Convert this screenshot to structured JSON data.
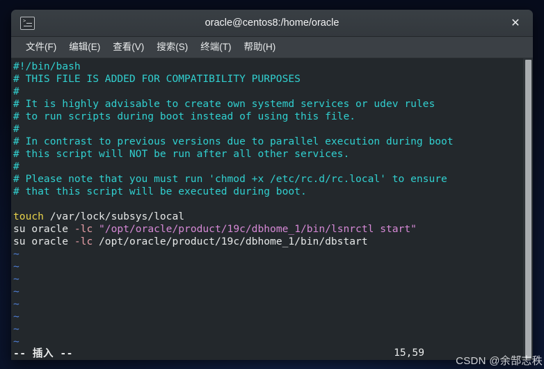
{
  "window": {
    "title": "oracle@centos8:/home/oracle",
    "icon": "terminal-icon",
    "close_label": "✕"
  },
  "menubar": {
    "items": [
      {
        "label": "文件(F)",
        "name": "menu-file"
      },
      {
        "label": "编辑(E)",
        "name": "menu-edit"
      },
      {
        "label": "查看(V)",
        "name": "menu-view"
      },
      {
        "label": "搜索(S)",
        "name": "menu-search"
      },
      {
        "label": "终端(T)",
        "name": "menu-terminal"
      },
      {
        "label": "帮助(H)",
        "name": "menu-help"
      }
    ]
  },
  "editor": {
    "lines": [
      {
        "text": "#!/bin/bash",
        "class": "c-comment"
      },
      {
        "text": "# THIS FILE IS ADDED FOR COMPATIBILITY PURPOSES",
        "class": "c-comment"
      },
      {
        "text": "#",
        "class": "c-comment"
      },
      {
        "text": "# It is highly advisable to create own systemd services or udev rules",
        "class": "c-comment"
      },
      {
        "text": "# to run scripts during boot instead of using this file.",
        "class": "c-comment"
      },
      {
        "text": "#",
        "class": "c-comment"
      },
      {
        "text": "# In contrast to previous versions due to parallel execution during boot",
        "class": "c-comment"
      },
      {
        "text": "# this script will NOT be run after all other services.",
        "class": "c-comment"
      },
      {
        "text": "#",
        "class": "c-comment"
      },
      {
        "text": "# Please note that you must run 'chmod +x /etc/rc.d/rc.local' to ensure",
        "class": "c-comment"
      },
      {
        "text": "# that this script will be executed during boot.",
        "class": "c-comment"
      },
      {
        "text": "",
        "class": "c-normal"
      },
      {
        "spans": [
          {
            "text": "touch",
            "class": "c-kw"
          },
          {
            "text": " /var/lock/subsys/local",
            "class": "c-normal"
          }
        ]
      },
      {
        "spans": [
          {
            "text": "su oracle ",
            "class": "c-normal"
          },
          {
            "text": "-lc",
            "class": "c-flag"
          },
          {
            "text": " ",
            "class": "c-normal"
          },
          {
            "text": "\"/opt/oracle/product/19c/dbhome_1/bin/lsnrctl start\"",
            "class": "c-string"
          }
        ]
      },
      {
        "spans": [
          {
            "text": "su oracle ",
            "class": "c-normal"
          },
          {
            "text": "-lc",
            "class": "c-flag"
          },
          {
            "text": " /opt/oracle/product/19c/dbhome_1/bin/dbstart",
            "class": "c-normal"
          }
        ]
      },
      {
        "text": "~",
        "class": "c-tilde"
      },
      {
        "text": "~",
        "class": "c-tilde"
      },
      {
        "text": "~",
        "class": "c-tilde"
      },
      {
        "text": "~",
        "class": "c-tilde"
      },
      {
        "text": "~",
        "class": "c-tilde"
      },
      {
        "text": "~",
        "class": "c-tilde"
      },
      {
        "text": "~",
        "class": "c-tilde"
      },
      {
        "text": "~",
        "class": "c-tilde"
      }
    ]
  },
  "statusline": {
    "mode": "-- 插入 --",
    "position": "15,59"
  },
  "watermark": {
    "text": "CSDN @余郜志秩"
  },
  "colors": {
    "titlebar": "#33383d",
    "menubar": "#3b4045",
    "terminal_bg": "#23282c",
    "comment": "#31d0d0",
    "keyword": "#e8d24a",
    "string": "#d689d6",
    "tilde": "#4f7fd8",
    "text": "#e6e8e8",
    "scrollbar": "#a9adb0",
    "desktop": "#0c1733"
  }
}
